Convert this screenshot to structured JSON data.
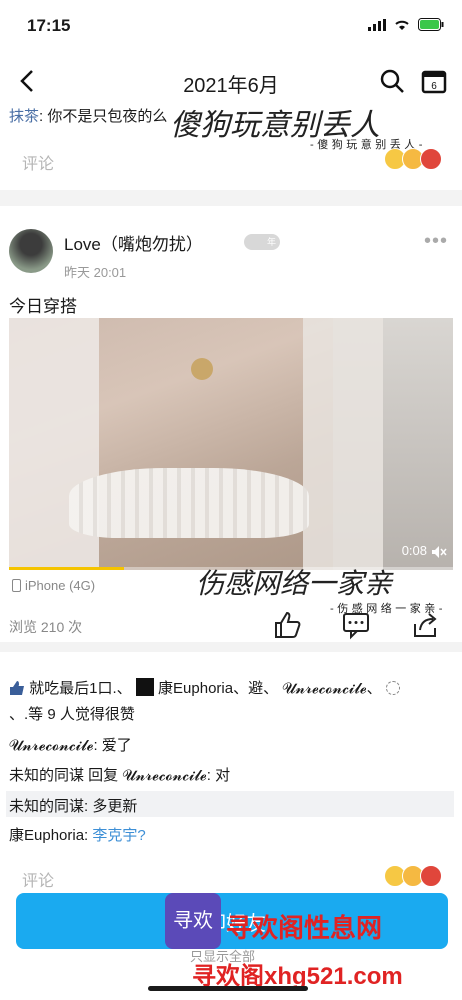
{
  "status": {
    "time": "17:15"
  },
  "nav": {
    "title": "2021年6月"
  },
  "prev_comment": {
    "name": "抹茶",
    "text": ": 你不是只包夜的么"
  },
  "comment_placeholder": "评论",
  "overlay_upper": {
    "main": "傻狗玩意别丢人",
    "sub": "- 傻 狗 玩 意 别 丢 人 -"
  },
  "post": {
    "author": "Love（嘴炮勿扰）",
    "badge": "年",
    "timestamp": "昨天 20:01",
    "text": "今日穿搭",
    "video_duration": "0:08",
    "video_progress": 0.26,
    "device": "iPhone (4G)",
    "views": "浏览 210 次"
  },
  "overlay_lower": {
    "main": "伤感网络一家亲",
    "sub": "- 伤 感 网 络 一 家 亲 -"
  },
  "likes": {
    "line1": "就吃最后1口.、",
    "names": "康Euphoria、避、 𝓤𝓷𝓻𝓮𝓬𝓸𝓷𝓬𝓲𝓵𝓮、",
    "line2": "、.等 9 人觉得很赞"
  },
  "replies": [
    {
      "name": "𝓤𝓷𝓻𝓮𝓬𝓸𝓷𝓬𝓲𝓵𝓮",
      "text": ": 爱了"
    },
    {
      "name": "未知的同谋 回复 𝓤𝓷𝓻𝓮𝓬𝓸𝓷𝓬𝓲𝓵𝓮",
      "text": ": 对"
    },
    {
      "name": "未知的同谋",
      "text": ": 多更新"
    },
    {
      "name": "康Euphoria",
      "text": ": ",
      "link": "李克宇?"
    }
  ],
  "banner": {
    "text": "卸好友",
    "sub": "只显示全部"
  },
  "watermark": {
    "line1": "寻欢阁性息网",
    "line2": "寻欢阁xhg521.com",
    "logo": "寻欢"
  },
  "colors": {
    "accent": "#1aaaf0",
    "link": "#3d8fd6",
    "watermark": "#e02323"
  }
}
